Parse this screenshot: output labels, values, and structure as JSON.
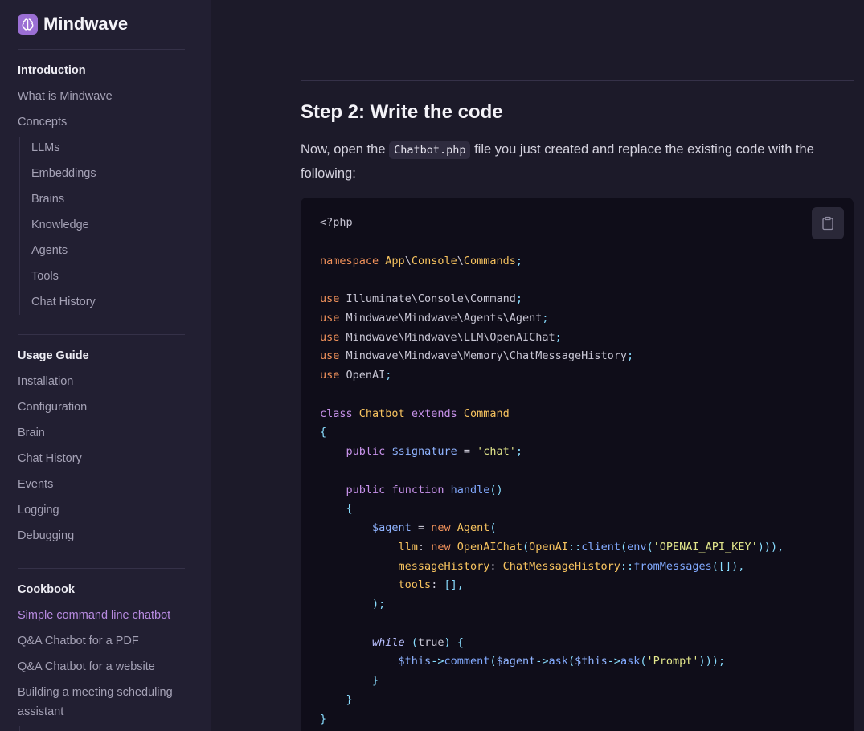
{
  "app": {
    "name": "Mindwave"
  },
  "sidebar": {
    "sections": [
      {
        "title": "Introduction",
        "items": [
          "What is Mindwave",
          "Concepts"
        ],
        "subitems": [
          "LLMs",
          "Embeddings",
          "Brains",
          "Knowledge",
          "Agents",
          "Tools",
          "Chat History"
        ]
      },
      {
        "title": "Usage Guide",
        "items": [
          "Installation",
          "Configuration",
          "Brain",
          "Chat History",
          "Events",
          "Logging",
          "Debugging"
        ]
      },
      {
        "title": "Cookbook",
        "items": [
          "Simple command line chatbot",
          "Q&A Chatbot for a PDF",
          "Q&A Chatbot for a website",
          "Building a meeting scheduling",
          "assistant"
        ],
        "active": "Simple command line chatbot"
      }
    ]
  },
  "main": {
    "heading": "Step 2: Write the code",
    "para_prefix": "Now, open the ",
    "para_code": "Chatbot.php",
    "para_suffix": " file you just created and replace the existing code with the following:",
    "code_lines": [
      "<?php",
      "",
      "namespace App\\Console\\Commands;",
      "",
      "use Illuminate\\Console\\Command;",
      "use Mindwave\\Mindwave\\Agents\\Agent;",
      "use Mindwave\\Mindwave\\LLM\\OpenAIChat;",
      "use Mindwave\\Mindwave\\Memory\\ChatMessageHistory;",
      "use OpenAI;",
      "",
      "class Chatbot extends Command",
      "{",
      "    public $signature = 'chat';",
      "",
      "    public function handle()",
      "    {",
      "        $agent = new Agent(",
      "            llm: new OpenAIChat(OpenAI::client(env('OPENAI_API_KEY'))),",
      "            messageHistory: ChatMessageHistory::fromMessages([]),",
      "            tools: [],",
      "        );",
      "",
      "        while (true) {",
      "            $this->comment($agent->ask($this->ask('Prompt')));",
      "        }",
      "    }",
      "}"
    ]
  },
  "colors": {
    "accent": "#b78ae0",
    "code_bg": "#0f0d19",
    "sidebar_bg": "#221f32",
    "page_bg": "#1c1a29"
  },
  "icons": {
    "logo": "brain-icon",
    "copy": "clipboard-icon"
  }
}
